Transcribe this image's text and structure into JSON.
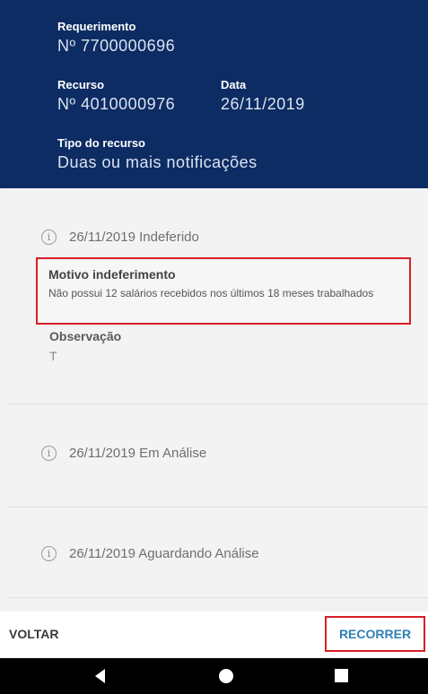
{
  "header": {
    "requerimento_label": "Requerimento",
    "requerimento_value": "Nº  7700000696",
    "recurso_label": "Recurso",
    "recurso_value": "Nº  4010000976",
    "data_label": "Data",
    "data_value": "26/11/2019",
    "tipo_label": "Tipo do recurso",
    "tipo_value": "Duas ou mais notificações"
  },
  "timeline": [
    {
      "icon": "info-icon",
      "status": "26/11/2019 Indeferido",
      "reason_label": "Motivo indeferimento",
      "reason_text": "Não possui 12 salários recebidos nos últimos 18 meses trabalhados",
      "observation_label": "Observação",
      "observation_value": "T"
    },
    {
      "icon": "info-icon",
      "status": "26/11/2019 Em Análise"
    },
    {
      "icon": "info-icon",
      "status": "26/11/2019 Aguardando Análise"
    }
  ],
  "footer": {
    "back_label": "VOLTAR",
    "appeal_label": "RECORRER"
  },
  "colors": {
    "header_bg": "#0d2c63",
    "highlight_border": "#d61f26",
    "action_blue": "#2f7fb5"
  },
  "navbar": {
    "icons": [
      "back-triangle-icon",
      "home-circle-icon",
      "recent-apps-square-icon"
    ]
  }
}
